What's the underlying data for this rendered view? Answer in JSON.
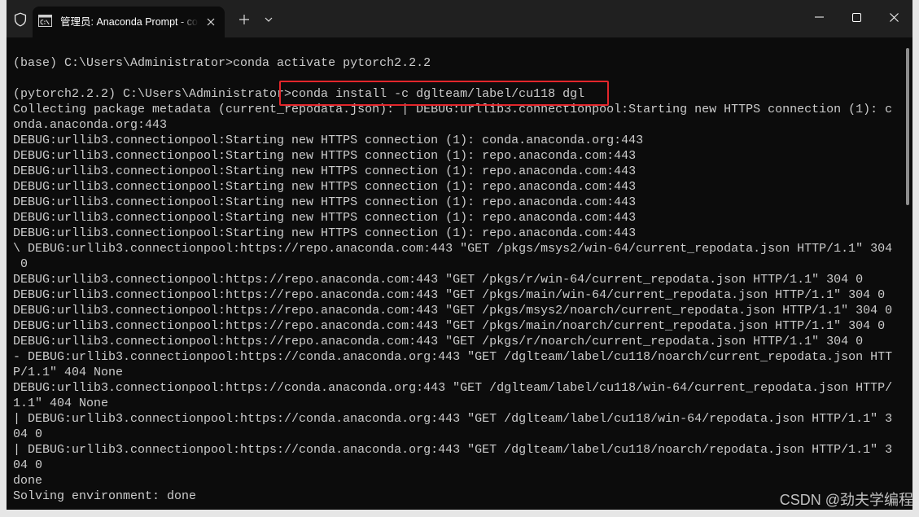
{
  "titlebar": {
    "tab": {
      "title": "管理员: Anaconda Prompt - co"
    },
    "icons": {
      "admin": "shield-icon",
      "tab": "command-prompt-icon",
      "tab_close": "close-icon",
      "new_tab": "plus-icon",
      "dropdown": "chevron-down-icon",
      "minimize": "minimize-icon",
      "maximize": "maximize-icon",
      "close": "close-icon"
    }
  },
  "terminal": {
    "lines": [
      "(base) C:\\Users\\Administrator>conda activate pytorch2.2.2",
      "",
      "(pytorch2.2.2) C:\\Users\\Administrator>conda install -c dglteam/label/cu118 dgl",
      "Collecting package metadata (current_repodata.json): | DEBUG:urllib3.connectionpool:Starting new HTTPS connection (1): c",
      "onda.anaconda.org:443",
      "DEBUG:urllib3.connectionpool:Starting new HTTPS connection (1): conda.anaconda.org:443",
      "DEBUG:urllib3.connectionpool:Starting new HTTPS connection (1): repo.anaconda.com:443",
      "DEBUG:urllib3.connectionpool:Starting new HTTPS connection (1): repo.anaconda.com:443",
      "DEBUG:urllib3.connectionpool:Starting new HTTPS connection (1): repo.anaconda.com:443",
      "DEBUG:urllib3.connectionpool:Starting new HTTPS connection (1): repo.anaconda.com:443",
      "DEBUG:urllib3.connectionpool:Starting new HTTPS connection (1): repo.anaconda.com:443",
      "DEBUG:urllib3.connectionpool:Starting new HTTPS connection (1): repo.anaconda.com:443",
      "\\ DEBUG:urllib3.connectionpool:https://repo.anaconda.com:443 \"GET /pkgs/msys2/win-64/current_repodata.json HTTP/1.1\" 304",
      " 0",
      "DEBUG:urllib3.connectionpool:https://repo.anaconda.com:443 \"GET /pkgs/r/win-64/current_repodata.json HTTP/1.1\" 304 0",
      "DEBUG:urllib3.connectionpool:https://repo.anaconda.com:443 \"GET /pkgs/main/win-64/current_repodata.json HTTP/1.1\" 304 0",
      "DEBUG:urllib3.connectionpool:https://repo.anaconda.com:443 \"GET /pkgs/msys2/noarch/current_repodata.json HTTP/1.1\" 304 0",
      "DEBUG:urllib3.connectionpool:https://repo.anaconda.com:443 \"GET /pkgs/main/noarch/current_repodata.json HTTP/1.1\" 304 0",
      "DEBUG:urllib3.connectionpool:https://repo.anaconda.com:443 \"GET /pkgs/r/noarch/current_repodata.json HTTP/1.1\" 304 0",
      "- DEBUG:urllib3.connectionpool:https://conda.anaconda.org:443 \"GET /dglteam/label/cu118/noarch/current_repodata.json HTT",
      "P/1.1\" 404 None",
      "DEBUG:urllib3.connectionpool:https://conda.anaconda.org:443 \"GET /dglteam/label/cu118/win-64/current_repodata.json HTTP/",
      "1.1\" 404 None",
      "| DEBUG:urllib3.connectionpool:https://conda.anaconda.org:443 \"GET /dglteam/label/cu118/win-64/repodata.json HTTP/1.1\" 3",
      "04 0",
      "| DEBUG:urllib3.connectionpool:https://conda.anaconda.org:443 \"GET /dglteam/label/cu118/noarch/repodata.json HTTP/1.1\" 3",
      "04 0",
      "done",
      "Solving environment: done"
    ]
  },
  "watermark": {
    "text": "CSDN @劲夫学编程"
  },
  "colors": {
    "titlebar_bg": "#202020",
    "terminal_bg": "#0c0c0c",
    "terminal_fg": "#cccccc",
    "highlight": "#e3262b"
  }
}
